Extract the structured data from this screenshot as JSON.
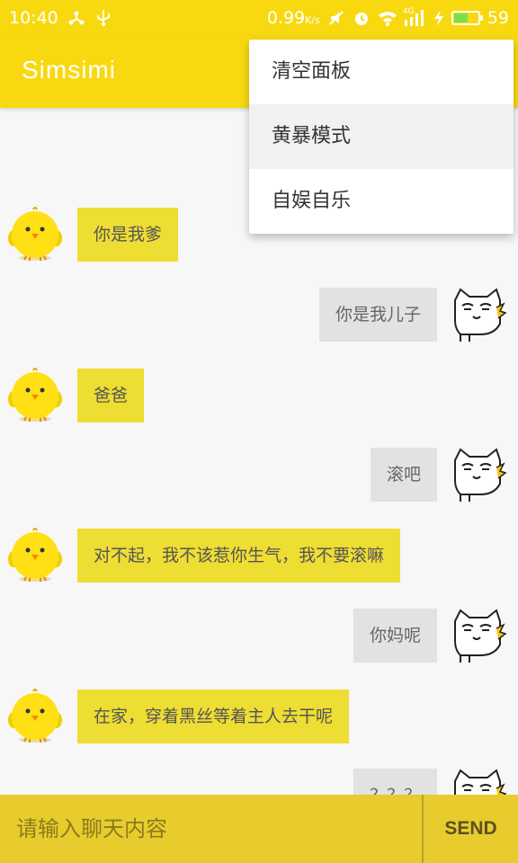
{
  "status_bar": {
    "time": "10:40",
    "net_speed": "0.99",
    "net_speed_unit": "K/s",
    "network_type": "4G",
    "battery_level": "59",
    "battery_fraction": 0.59,
    "icons": [
      "share-icon",
      "usb-icon",
      "mute-icon",
      "alarm-icon",
      "wifi-icon",
      "signal-icon",
      "charging-icon",
      "battery-icon"
    ]
  },
  "app_bar": {
    "title": "Simsimi"
  },
  "menu": {
    "items": [
      {
        "label": "清空面板"
      },
      {
        "label": "黄暴模式"
      },
      {
        "label": "自娱自乐"
      }
    ]
  },
  "chat": {
    "messages": [
      {
        "sender": "bot",
        "text": "你是我爹"
      },
      {
        "sender": "user",
        "text": "你是我儿子"
      },
      {
        "sender": "bot",
        "text": "爸爸"
      },
      {
        "sender": "user",
        "text": "滚吧"
      },
      {
        "sender": "bot",
        "text": "对不起，我不该惹你生气，我不要滚嘛"
      },
      {
        "sender": "user",
        "text": "你妈呢"
      },
      {
        "sender": "bot",
        "text": "在家，穿着黑丝等着主人去干呢"
      },
      {
        "sender": "user",
        "text": "？？？"
      }
    ]
  },
  "input_bar": {
    "placeholder": "请输入聊天内容",
    "send_label": "SEND"
  },
  "colors": {
    "primary": "#f8d910",
    "bot_bubble": "#eedd33",
    "user_bubble": "#e2e2e2",
    "bottom_bar": "#e8cc2e"
  }
}
